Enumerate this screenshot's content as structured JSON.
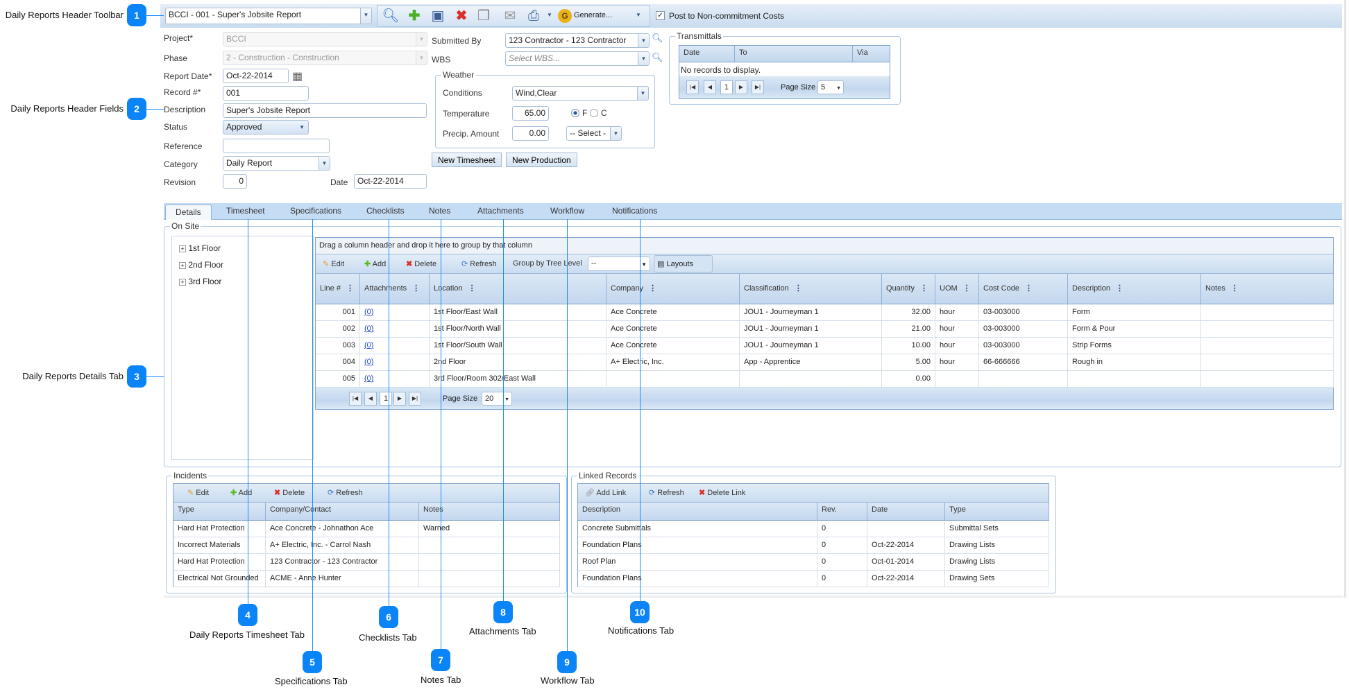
{
  "toolbar": {
    "record_select": "BCCI - 001 - Super's Jobsite Report",
    "icons": [
      "search-icon",
      "new-icon",
      "save-icon",
      "delete-icon",
      "copy-icon",
      "email-icon",
      "print-icon",
      "generate-icon"
    ],
    "generate_label": "Generate...",
    "post_label": "Post to Non-commitment Costs",
    "post_checked": true
  },
  "fields": {
    "project_label": "Project*",
    "project_value": "BCCI",
    "phase_label": "Phase",
    "phase_value": "2 - Construction - Construction",
    "report_date_label": "Report Date*",
    "report_date_value": "Oct-22-2014",
    "record_label": "Record #*",
    "record_value": "001",
    "description_label": "Description",
    "description_value": "Super's Jobsite Report",
    "status_label": "Status",
    "status_value": "Approved",
    "reference_label": "Reference",
    "reference_value": "",
    "category_label": "Category",
    "category_value": "Daily Report",
    "revision_label": "Revision",
    "revision_value": "0",
    "date_label": "Date",
    "date_value": "Oct-22-2014",
    "submitted_by_label": "Submitted By",
    "submitted_by_value": "123 Contractor - 123 Contractor",
    "wbs_label": "WBS",
    "wbs_placeholder": "Select WBS..."
  },
  "weather": {
    "title": "Weather",
    "conditions_label": "Conditions",
    "conditions_value": "Wind,Clear",
    "temperature_label": "Temperature",
    "temperature_value": "65.00",
    "unit_f": "F",
    "unit_c": "C",
    "unit_selected": "F",
    "precip_label": "Precip. Amount",
    "precip_value": "0.00",
    "precip_unit": "-- Select -"
  },
  "buttons": {
    "new_timesheet": "New Timesheet",
    "new_production": "New Production"
  },
  "transmittals": {
    "title": "Transmittals",
    "columns": [
      "Date",
      "To",
      "Via"
    ],
    "empty": "No records to display.",
    "page": "1",
    "page_size_label": "Page Size",
    "page_size": "5"
  },
  "tabs": [
    "Details",
    "Timesheet",
    "Specifications",
    "Checklists",
    "Notes",
    "Attachments",
    "Workflow",
    "Notifications"
  ],
  "active_tab": "Details",
  "onsite": {
    "title": "On Site",
    "tree": [
      "1st Floor",
      "2nd Floor",
      "3rd Floor"
    ],
    "group_hint": "Drag a column header and drop it here to group by that column",
    "toolbar": {
      "edit": "Edit",
      "add": "Add",
      "delete": "Delete",
      "refresh": "Refresh",
      "group_by": "Group by Tree Level",
      "group_value": "--",
      "layouts": "Layouts"
    },
    "columns": [
      "Line #",
      "Attachments",
      "Location",
      "Company",
      "Classification",
      "Quantity",
      "UOM",
      "Cost Code",
      "Description",
      "Notes"
    ],
    "rows": [
      [
        "001",
        "(0)",
        "1st Floor/East Wall",
        "Ace Concrete",
        "JOU1 - Journeyman 1",
        "32.00",
        "hour",
        "03-003000",
        "Form",
        ""
      ],
      [
        "002",
        "(0)",
        "1st Floor/North Wall",
        "Ace Concrete",
        "JOU1 - Journeyman 1",
        "21.00",
        "hour",
        "03-003000",
        "Form & Pour",
        ""
      ],
      [
        "003",
        "(0)",
        "1st Floor/South Wall",
        "Ace Concrete",
        "JOU1 - Journeyman 1",
        "10.00",
        "hour",
        "03-003000",
        "Strip Forms",
        ""
      ],
      [
        "004",
        "(0)",
        "2nd Floor",
        "A+ Electric, Inc.",
        "App - Apprentice",
        "5.00",
        "hour",
        "66-666666",
        "Rough in",
        ""
      ],
      [
        "005",
        "(0)",
        "3rd Floor/Room 302/East Wall",
        "",
        "",
        "0.00",
        "",
        "",
        "",
        ""
      ]
    ],
    "page": "1",
    "page_size_label": "Page Size",
    "page_size": "20"
  },
  "incidents": {
    "title": "Incidents",
    "toolbar": {
      "edit": "Edit",
      "add": "Add",
      "delete": "Delete",
      "refresh": "Refresh"
    },
    "columns": [
      "Type",
      "Company/Contact",
      "Notes"
    ],
    "rows": [
      [
        "Hard Hat Protection",
        "Ace Concrete - Johnathon Ace",
        "Warned"
      ],
      [
        "Incorrect Materials",
        "A+ Electric, Inc. - Carrol Nash",
        ""
      ],
      [
        "Hard Hat Protection",
        "123 Contractor - 123 Contractor",
        ""
      ],
      [
        "Electrical Not Grounded",
        "ACME - Anne Hunter",
        ""
      ]
    ]
  },
  "linked": {
    "title": "Linked Records",
    "toolbar": {
      "add_link": "Add Link",
      "refresh": "Refresh",
      "delete_link": "Delete Link"
    },
    "columns": [
      "Description",
      "Rev.",
      "Date",
      "Type"
    ],
    "rows": [
      [
        "Concrete Submittals",
        "0",
        "",
        "Submittal Sets"
      ],
      [
        "Foundation Plans",
        "0",
        "Oct-22-2014",
        "Drawing Lists"
      ],
      [
        "Roof Plan",
        "0",
        "Oct-01-2014",
        "Drawing Lists"
      ],
      [
        "Foundation Plans",
        "0",
        "Oct-22-2014",
        "Drawing Sets"
      ]
    ]
  },
  "annotations": [
    {
      "n": "1",
      "label": "Daily Reports Header Toolbar"
    },
    {
      "n": "2",
      "label": "Daily Reports Header Fields"
    },
    {
      "n": "3",
      "label": "Daily Reports Details Tab"
    },
    {
      "n": "4",
      "label": "Daily Reports Timesheet Tab"
    },
    {
      "n": "5",
      "label": "Specifications Tab"
    },
    {
      "n": "6",
      "label": "Checklists Tab"
    },
    {
      "n": "7",
      "label": "Notes Tab"
    },
    {
      "n": "8",
      "label": "Attachments Tab"
    },
    {
      "n": "9",
      "label": "Workflow Tab"
    },
    {
      "n": "10",
      "label": "Notifications Tab"
    }
  ],
  "colors": {
    "accent": "#0b84f7",
    "toolbar": "#c9dbef",
    "grid_border": "#7fa3cc"
  }
}
